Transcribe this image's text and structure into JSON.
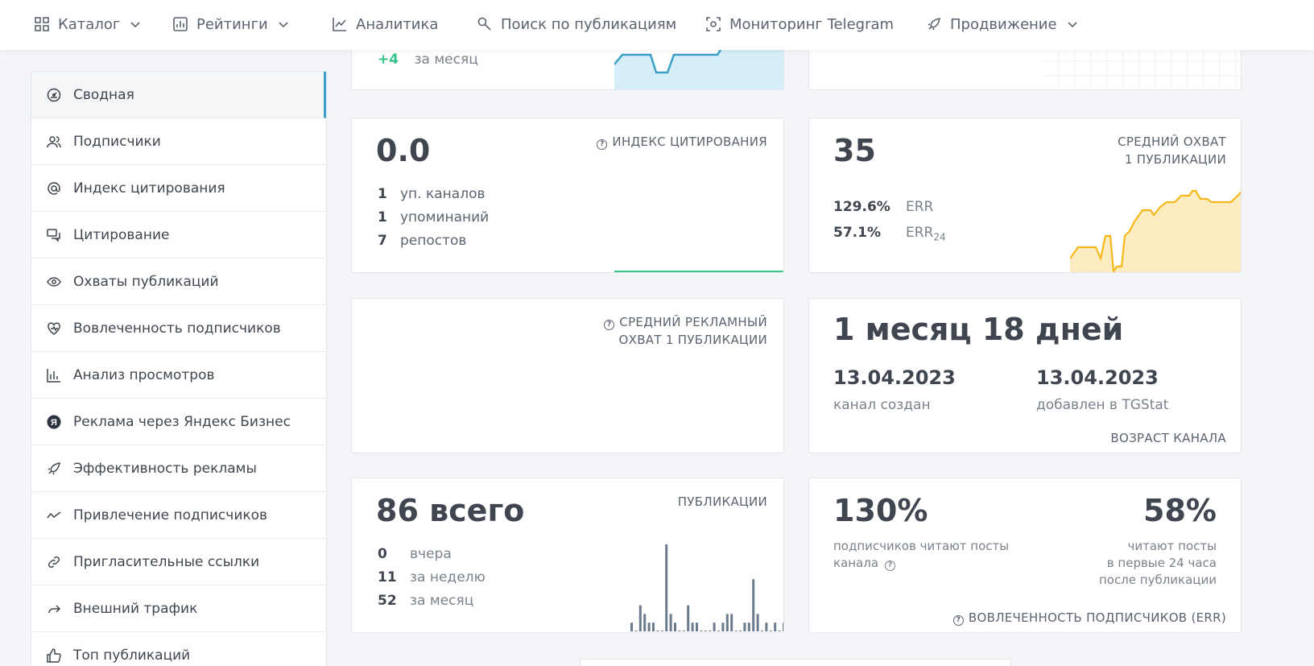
{
  "nav": {
    "catalog": "Каталог",
    "ratings": "Рейтинги",
    "analytics": "Аналитика",
    "search": "Поиск по публикациям",
    "monitoring": "Мониторинг Telegram",
    "promotion": "Продвижение"
  },
  "sidebar": {
    "items": [
      {
        "label": "Сводная",
        "icon": "dashboard-icon"
      },
      {
        "label": "Подписчики",
        "icon": "users-icon"
      },
      {
        "label": "Индекс цитирования",
        "icon": "at-icon"
      },
      {
        "label": "Цитирование",
        "icon": "quote-icon"
      },
      {
        "label": "Охваты публикаций",
        "icon": "eye-icon"
      },
      {
        "label": "Вовлеченность подписчиков",
        "icon": "heart-icon"
      },
      {
        "label": "Анализ просмотров",
        "icon": "bar-chart-icon"
      },
      {
        "label": "Реклама через Яндекс Бизнес",
        "icon": "yandex-icon"
      },
      {
        "label": "Эффективность рекламы",
        "icon": "rocket-icon"
      },
      {
        "label": "Привлечение подписчиков",
        "icon": "trend-icon"
      },
      {
        "label": "Пригласительные ссылки",
        "icon": "link-icon"
      },
      {
        "label": "Внешний трафик",
        "icon": "share-icon"
      },
      {
        "label": "Топ публикаций",
        "icon": "thumbs-up-icon"
      }
    ]
  },
  "subscribers_card": {
    "delta": "+4",
    "delta_label": "за месяц"
  },
  "citation_card": {
    "value": "0.0",
    "caption": "ИНДЕКС ЦИТИРОВАНИЯ",
    "rows": [
      {
        "num": "1",
        "label": "уп. каналов"
      },
      {
        "num": "1",
        "label": "упоминаний"
      },
      {
        "num": "7",
        "label": "репостов"
      }
    ]
  },
  "reach_card": {
    "value": "35",
    "caption_line1": "СРЕДНИЙ ОХВАТ",
    "caption_line2": "1 ПУБЛИКАЦИИ",
    "err_value": "129.6%",
    "err_label": "ERR",
    "err24_value": "57.1%",
    "err24_label": "ERR",
    "err24_sub": "24"
  },
  "ad_reach_card": {
    "caption_line1": "СРЕДНИЙ РЕКЛАМНЫЙ",
    "caption_line2": "ОХВАТ 1 ПУБЛИКАЦИИ"
  },
  "age_card": {
    "value": "1 месяц 18 дней",
    "created_date": "13.04.2023",
    "created_label": "канал создан",
    "added_date": "13.04.2023",
    "added_label": "добавлен в TGStat",
    "caption": "ВОЗРАСТ КАНАЛА"
  },
  "posts_card": {
    "value": "86 всего",
    "caption": "ПУБЛИКАЦИИ",
    "rows": [
      {
        "num": "0",
        "label": "вчера"
      },
      {
        "num": "11",
        "label": "за неделю"
      },
      {
        "num": "52",
        "label": "за месяц"
      }
    ],
    "daily_posts": [
      1,
      0,
      3,
      2,
      1,
      1,
      0,
      0,
      10,
      2,
      1,
      0,
      0,
      3,
      1,
      1,
      0,
      0,
      0,
      1,
      0,
      1,
      2,
      2,
      0,
      0,
      1,
      1,
      6,
      2,
      0,
      1,
      0,
      1,
      0,
      1
    ]
  },
  "engagement_card": {
    "left_value": "130%",
    "left_label_line1": "подписчиков читают посты",
    "left_label_line2": "канала",
    "right_value": "58%",
    "right_label_line1": "читают посты",
    "right_label_line2": "в первые 24 часа",
    "right_label_line3": "после публикации",
    "caption": "ВОВЛЕЧЕННОСТЬ ПОДПИСЧИКОВ (ERR)"
  },
  "colors": {
    "accent": "#3aa0c8",
    "yellow": "#f4b81a",
    "green": "#36c389",
    "bar": "#6b7a8c"
  }
}
